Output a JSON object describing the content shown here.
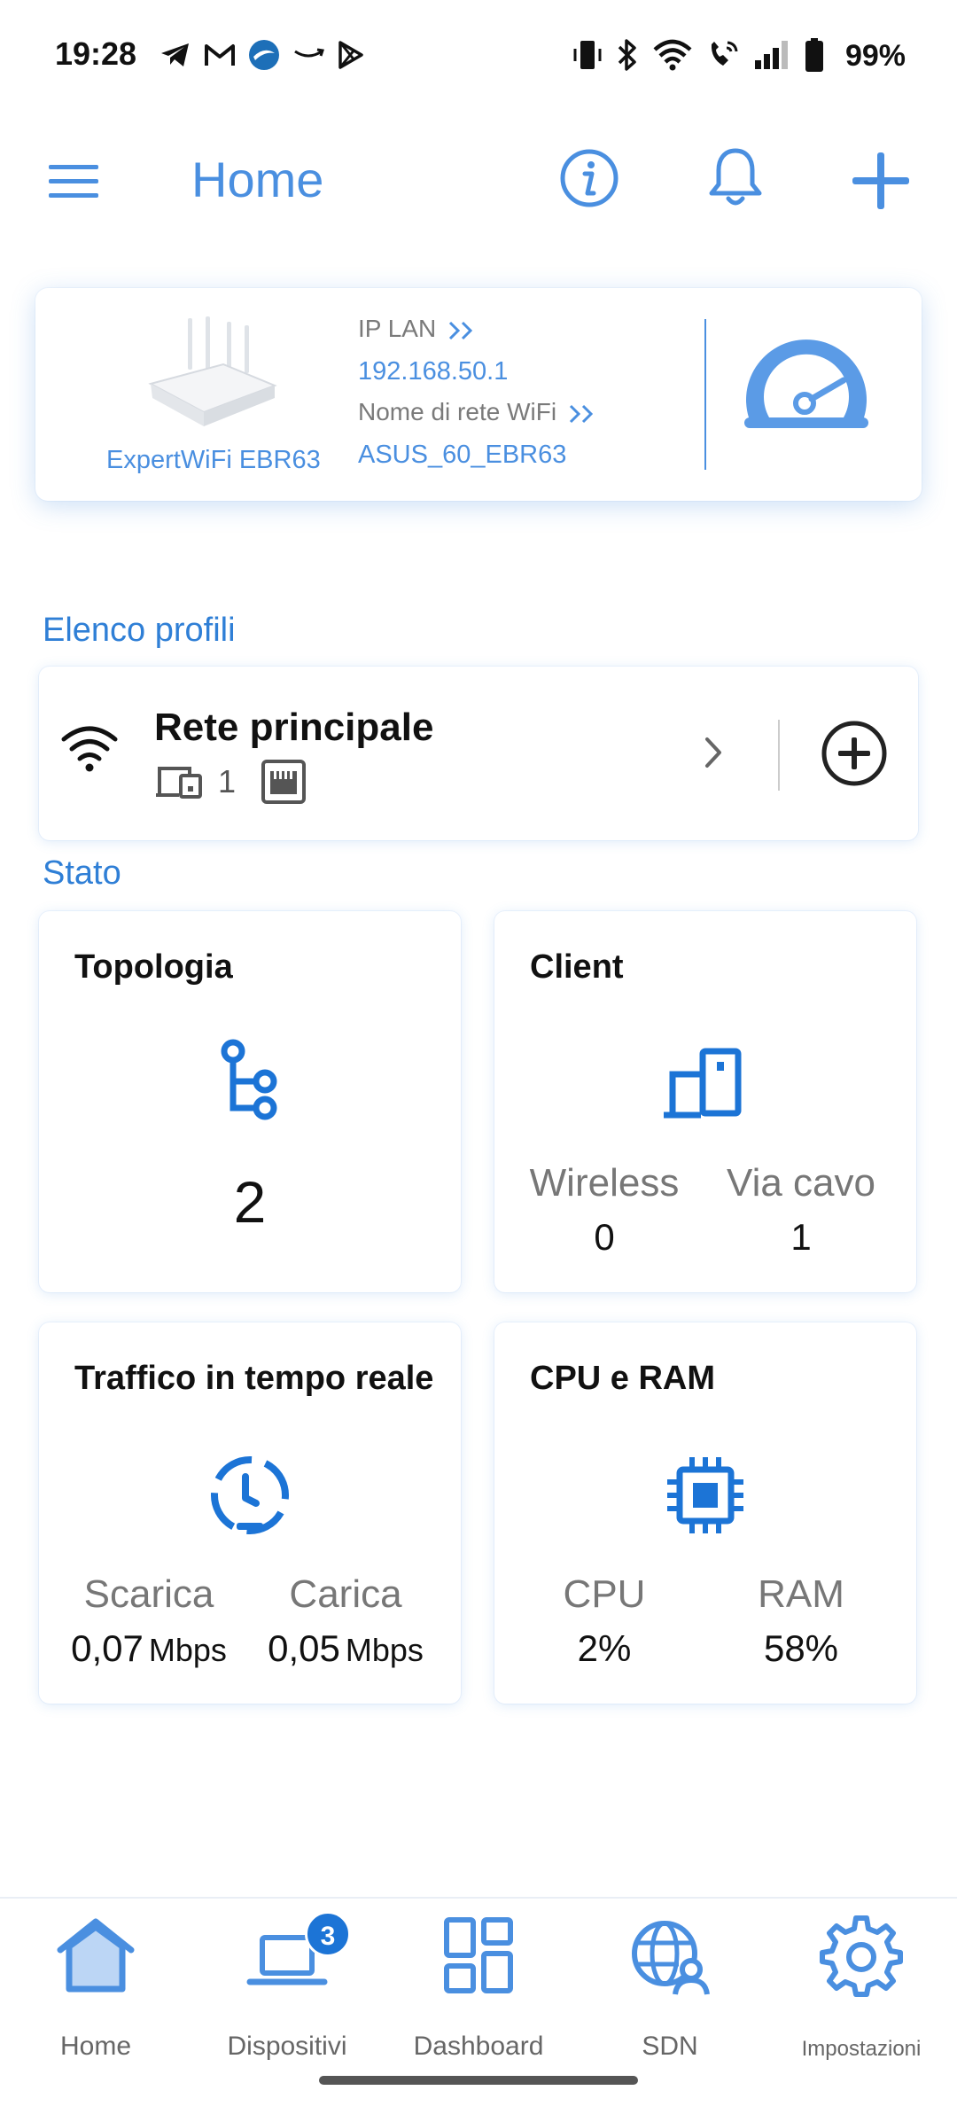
{
  "status_bar": {
    "time": "19:28",
    "battery": "99%",
    "left_icons": [
      "telegram-icon",
      "gmail-icon",
      "app-icon",
      "amazon-icon",
      "play-store-icon"
    ],
    "right_icons": [
      "vibrate-icon",
      "bluetooth-icon",
      "wifi-icon",
      "wifi-call-icon",
      "signal-icon",
      "battery-icon"
    ]
  },
  "header": {
    "title": "Home"
  },
  "router": {
    "model": "ExpertWiFi EBR63",
    "lan_label": "IP LAN",
    "lan_ip": "192.168.50.1",
    "wifi_label": "Nome di rete WiFi",
    "wifi_name": "ASUS_60_EBR63"
  },
  "profiles": {
    "section_title": "Elenco profili",
    "items": [
      {
        "name": "Rete principale",
        "device_count": "1"
      }
    ]
  },
  "status": {
    "section_title": "Stato",
    "topology": {
      "title": "Topologia",
      "value": "2"
    },
    "client": {
      "title": "Client",
      "wireless_label": "Wireless",
      "wireless_value": "0",
      "wired_label": "Via cavo",
      "wired_value": "1"
    },
    "traffic": {
      "title": "Traffico in tempo reale",
      "download_label": "Scarica",
      "download_value": "0,07",
      "upload_label": "Carica",
      "upload_value": "0,05",
      "unit": "Mbps"
    },
    "cpu_ram": {
      "title": "CPU e RAM",
      "cpu_label": "CPU",
      "cpu_value": "2%",
      "ram_label": "RAM",
      "ram_value": "58%"
    }
  },
  "nav": {
    "items": [
      {
        "label": "Home",
        "icon": "home-icon"
      },
      {
        "label": "Dispositivi",
        "icon": "devices-icon",
        "badge": "3"
      },
      {
        "label": "Dashboard",
        "icon": "dashboard-icon"
      },
      {
        "label": "SDN",
        "icon": "sdn-icon"
      },
      {
        "label": "Impostazioni",
        "icon": "gear-icon"
      }
    ]
  },
  "colors": {
    "accent": "#4a8fe0",
    "accent_dark": "#1c74d6",
    "section": "#2f7fd6"
  }
}
